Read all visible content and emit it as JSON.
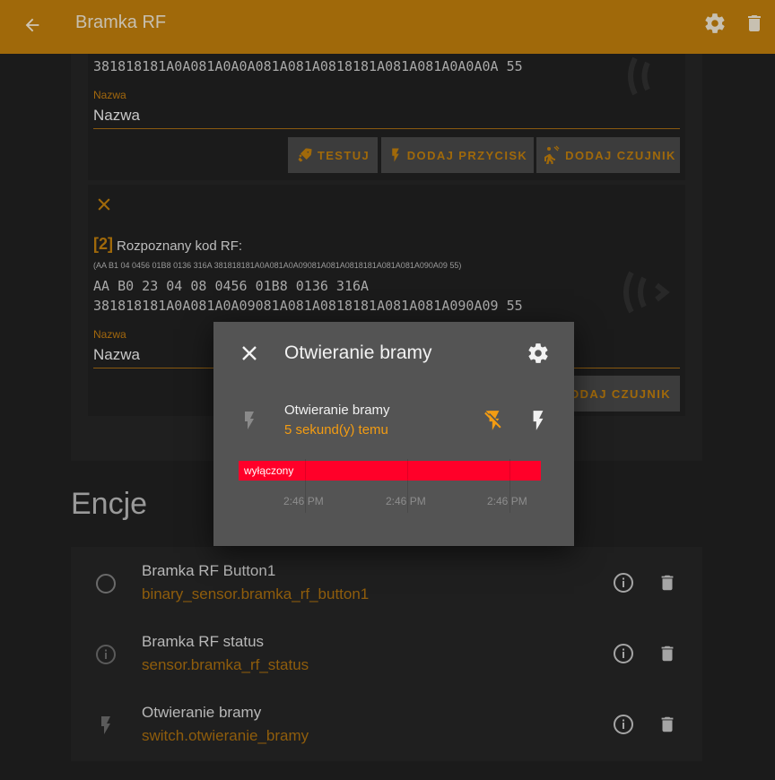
{
  "header": {
    "title": "Bramka RF"
  },
  "codes": {
    "first": {
      "code_line": "381818181A0A081A0A0A081A081A0818181A081A081A0A0A0A 55",
      "field_label": "Nazwa",
      "field_value": "Nazwa",
      "buttons": {
        "test": "TESTUJ",
        "add_button": "DODAJ PRZYCISK",
        "add_sensor": "DODAJ CZUJNIK"
      }
    },
    "second": {
      "index": "[2]",
      "recognized_label": "Rozpoznany kod RF:",
      "raw": "(AA B1 04 0456 01B8 0136 316A 381818181A0A081A0A09081A081A0818181A081A081A090A09 55)",
      "code_line1": "AA B0 23 04 08 0456 01B8 0136 316A",
      "code_line2": "381818181A0A081A0A09081A081A0818181A081A081A090A09 55",
      "field_label": "Nazwa",
      "field_value": "Nazwa",
      "add_sensor_partial": "ODAJ CZUJNIK"
    }
  },
  "section": {
    "title": "Encje"
  },
  "entities": [
    {
      "name": "Bramka RF Button1",
      "entity_id": "binary_sensor.bramka_rf_button1",
      "icon": "circle-outline-icon"
    },
    {
      "name": "Bramka RF status",
      "entity_id": "sensor.bramka_rf_status",
      "icon": "info-icon"
    },
    {
      "name": "Otwieranie bramy",
      "entity_id": "switch.otwieranie_bramy",
      "icon": "flash-icon"
    }
  ],
  "dialog": {
    "title": "Otwieranie bramy",
    "entity_name": "Otwieranie bramy",
    "last_changed": "5 sekund(y) temu",
    "timeline_state": "wyłączony",
    "timeline_labels": [
      "2:46 PM",
      "2:46 PM",
      "2:46 PM"
    ],
    "colors": {
      "state_off": "#ff0029",
      "accent": "#f39c12"
    }
  },
  "theme": {
    "primary": "#a0690a",
    "background": "#1b1b1b"
  }
}
